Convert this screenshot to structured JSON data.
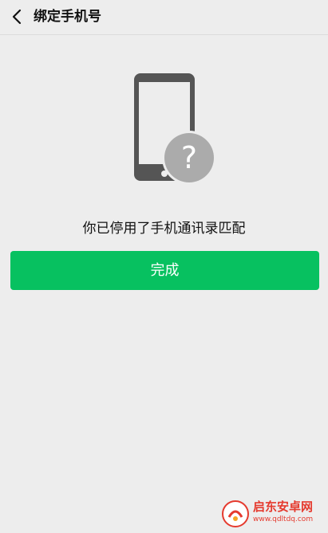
{
  "header": {
    "title": "绑定手机号",
    "back_icon": "chevron-left-icon"
  },
  "illustration": {
    "icon": "phone-question-icon",
    "question_mark": "?"
  },
  "main": {
    "message": "你已停用了手机通讯录匹配",
    "done_label": "完成"
  },
  "watermark": {
    "name": "启东安卓网",
    "url": "www.qdltdq.com"
  },
  "colors": {
    "background": "#ededed",
    "primary_button": "#07c160",
    "phone_body": "#555555",
    "question_badge": "#ababab",
    "watermark": "#e53a2e"
  }
}
